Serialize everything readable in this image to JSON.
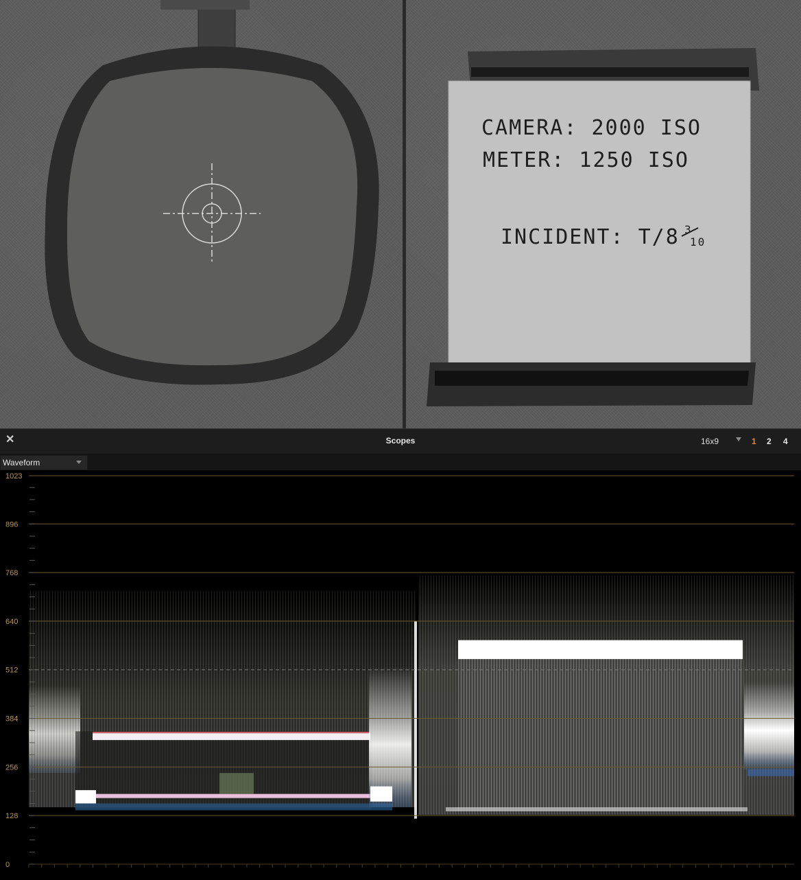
{
  "viewer": {
    "slate": {
      "line1": "CAMERA: 2000 ISO",
      "line2": "METER: 1250 ISO",
      "line3": "INCIDENT: T/8",
      "line3_fraction_num": "3",
      "line3_fraction_den": "10"
    }
  },
  "scopes": {
    "title": "Scopes",
    "close_symbol": "✕",
    "aspect": "16x9",
    "layouts": [
      {
        "label": "1",
        "active": true
      },
      {
        "label": "2",
        "active": false
      },
      {
        "label": "4",
        "active": false
      }
    ],
    "scope_type": "Waveform",
    "graticule": {
      "labels": [
        "1023",
        "896",
        "768",
        "640",
        "512",
        "384",
        "256",
        "128",
        "0"
      ],
      "values": [
        1023,
        896,
        768,
        640,
        512,
        384,
        256,
        128,
        0
      ],
      "dashed_value": 512
    },
    "colors": {
      "graticule": "#6e5a2c",
      "label": "#b9954f",
      "active_layout": "#e8872a",
      "inactive_layout": "#e6e6e6"
    }
  }
}
